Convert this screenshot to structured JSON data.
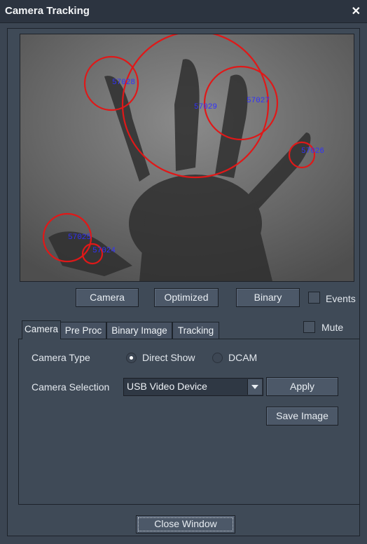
{
  "window": {
    "title": "Camera Tracking"
  },
  "video": {
    "blobs": [
      {
        "id": "57028"
      },
      {
        "id": "57029"
      },
      {
        "id": "57027"
      },
      {
        "id": "57026"
      },
      {
        "id": "57025"
      },
      {
        "id": "57024"
      }
    ]
  },
  "view_buttons": {
    "camera": "Camera",
    "optimized": "Optimized",
    "binary": "Binary"
  },
  "events_label": "Events",
  "mute_label": "Mute",
  "tabs": [
    {
      "label": "Camera",
      "active": true
    },
    {
      "label": "Pre Proc",
      "active": false
    },
    {
      "label": "Binary Image",
      "active": false
    },
    {
      "label": "Tracking",
      "active": false
    }
  ],
  "camera_panel": {
    "camera_type_label": "Camera Type",
    "type_options": [
      "Direct Show",
      "DCAM"
    ],
    "selected_type": "Direct Show",
    "camera_selection_label": "Camera Selection",
    "camera_selection_value": "USB Video Device",
    "apply_label": "Apply",
    "save_image_label": "Save Image"
  },
  "close_window_label": "Close Window",
  "colors": {
    "accent_circle": "#e01818",
    "blob_label": "#3030ff",
    "background": "#3b4552"
  }
}
